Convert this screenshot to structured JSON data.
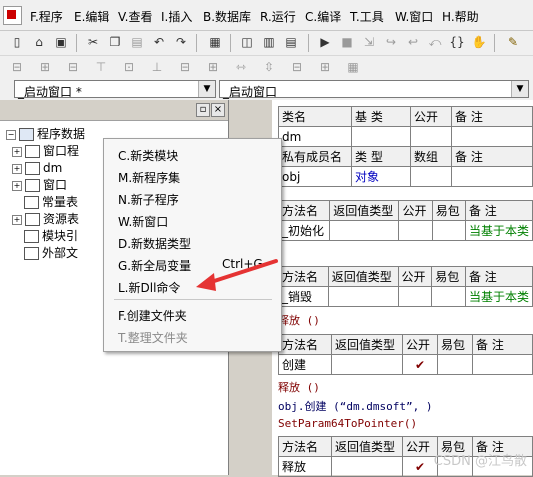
{
  "menubar": {
    "items": [
      "F.程序",
      "E.编辑",
      "V.查看",
      "I.插入",
      "B.数据库",
      "R.运行",
      "C.编译",
      "T.工具",
      "W.窗口",
      "H.帮助"
    ]
  },
  "toolbar": {
    "icons": [
      "new-file",
      "open-file",
      "save",
      "cut",
      "copy",
      "paste",
      "undo",
      "redo",
      "properties",
      "layout-1",
      "layout-2",
      "layout-3",
      "run",
      "stop",
      "step-into",
      "step-over",
      "step-out",
      "braces",
      "hand",
      "wrench"
    ]
  },
  "combos": {
    "left": "_启动窗口 *",
    "right": "_启动窗口"
  },
  "left_panel": {
    "root_label": "程序数据",
    "tree": [
      "窗口程",
      "dm",
      "窗口",
      "常量表",
      "资源表",
      "模块引",
      "外部文"
    ]
  },
  "context_menu": {
    "items": [
      {
        "label": "C.新类模块",
        "disabled": false
      },
      {
        "label": "M.新程序集",
        "disabled": false
      },
      {
        "label": "N.新子程序",
        "disabled": false
      },
      {
        "label": "W.新窗口",
        "disabled": false
      },
      {
        "label": "D.新数据类型",
        "disabled": false
      },
      {
        "label": "G.新全局变量",
        "shortcut": "Ctrl+G",
        "disabled": false
      },
      {
        "label": "L.新Dll命令",
        "disabled": false
      },
      {
        "label": "F.创建文件夹",
        "disabled": false
      },
      {
        "label": "T.整理文件夹",
        "disabled": true
      }
    ]
  },
  "class_table": {
    "header": [
      "类名",
      "基 类",
      "公开",
      "备 注"
    ],
    "row": [
      "dm",
      "",
      "",
      ""
    ]
  },
  "member_table": {
    "header": [
      "私有成员名",
      "类 型",
      "数组",
      "备 注"
    ],
    "row": [
      "obj",
      "对象",
      "",
      ""
    ]
  },
  "method1": {
    "header": [
      "方法名",
      "返回值类型",
      "公开",
      "易包",
      "备 注"
    ],
    "row": [
      "_初始化",
      "",
      "",
      "",
      "当基于本类"
    ]
  },
  "method2": {
    "header": [
      "方法名",
      "返回值类型",
      "公开",
      "易包",
      "备 注"
    ],
    "row": [
      "_销毁",
      "",
      "",
      "",
      "当基于本类"
    ],
    "code": "释放 ()"
  },
  "method3": {
    "header": [
      "方法名",
      "返回值类型",
      "公开",
      "易包",
      "备 注"
    ],
    "row": [
      "创建",
      "",
      "✔",
      "",
      ""
    ],
    "code": [
      "释放 ()",
      "obj.创建 (“dm.dmsoft”, )",
      "SetParam64ToPointer()"
    ]
  },
  "method4": {
    "header": [
      "方法名",
      "返回值类型",
      "公开",
      "易包",
      "备 注"
    ],
    "row": [
      "释放",
      "",
      "✔",
      "",
      ""
    ]
  },
  "watermark": "CSDN @江鸟散"
}
